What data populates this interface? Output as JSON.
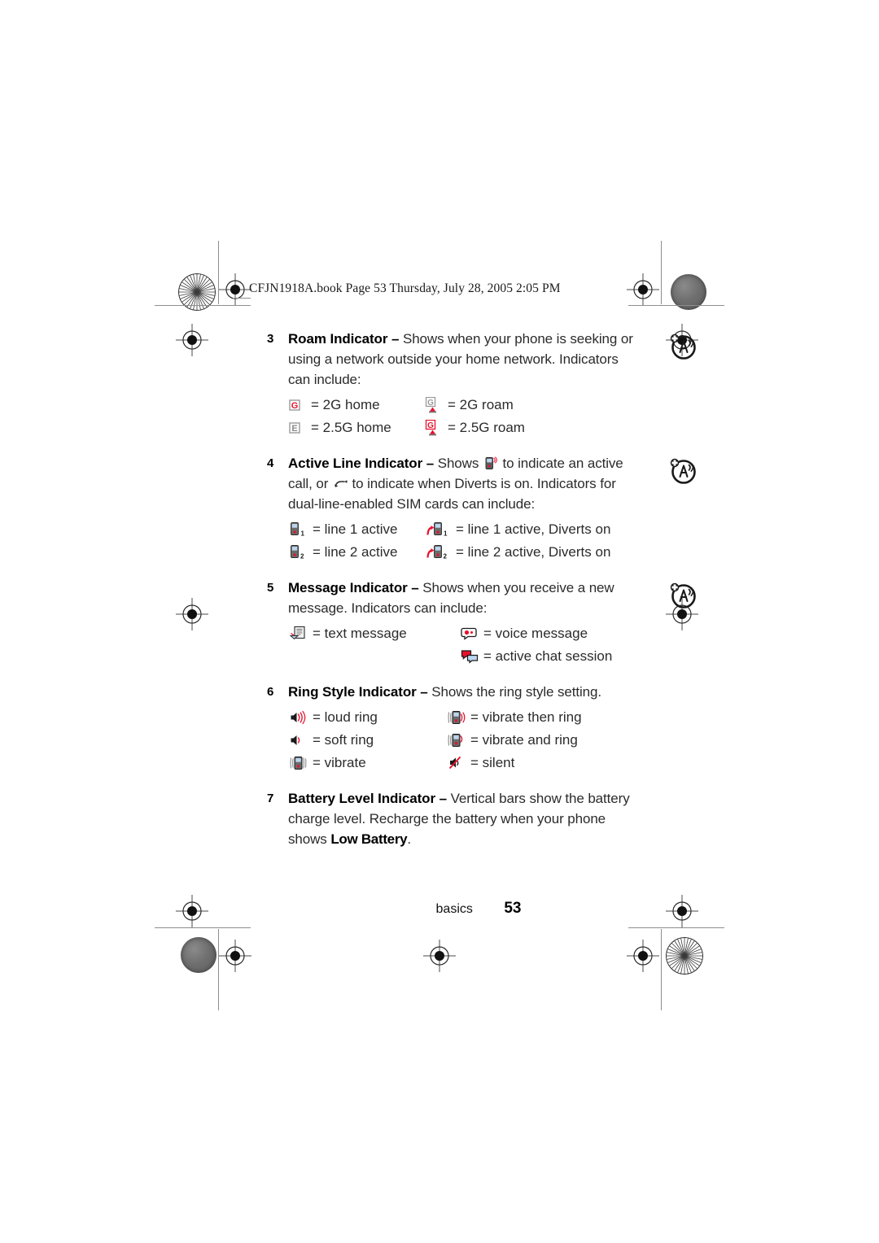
{
  "print_header": "CFJN1918A.book  Page 53  Thursday, July 28, 2005  2:05 PM",
  "items": [
    {
      "number": "3",
      "title": "Roam Indicator",
      "dash": "–",
      "body": " Shows when your phone is seeking or using a network outside your home network. Indicators can include:",
      "margin_icon": "roam-antenna-icon",
      "rows": [
        {
          "left_icon": "2g-home-icon",
          "left_label": "= 2G home",
          "right_icon": "2g-roam-icon",
          "right_label": "= 2G roam"
        },
        {
          "left_icon": "25g-home-icon",
          "left_label": "= 2.5G home",
          "right_icon": "25g-roam-icon",
          "right_label": "= 2.5G roam"
        }
      ]
    },
    {
      "number": "4",
      "title": "Active Line Indicator",
      "dash": "–",
      "body_pre": " Shows ",
      "body_mid": " to indicate an active call, or ",
      "body_post": " to indicate when Diverts is on. Indicators for dual-line-enabled SIM cards can include:",
      "inline_icon_1": "active-call-phone-icon",
      "inline_icon_2": "divert-icon",
      "margin_icon": "roam-antenna-icon",
      "rows": [
        {
          "left_icon": "line1-active-icon",
          "left_label": "= line 1 active",
          "right_icon": "line1-divert-icon",
          "right_label": "= line 1 active, Diverts on"
        },
        {
          "left_icon": "line2-active-icon",
          "left_label": "= line 2 active",
          "right_icon": "line2-divert-icon",
          "right_label": "= line 2 active, Diverts on"
        }
      ]
    },
    {
      "number": "5",
      "title": "Message Indicator",
      "dash": "–",
      "body": " Shows when you receive a new message. Indicators can include:",
      "margin_icon": "roam-antenna-icon",
      "rows": [
        {
          "left_icon": "text-message-icon",
          "left_label": "= text message",
          "right_icon": "voice-message-icon",
          "right_label": "= voice message"
        },
        {
          "left_icon": "",
          "left_label": "",
          "right_icon": "chat-session-icon",
          "right_label": "= active chat session"
        }
      ]
    },
    {
      "number": "6",
      "title": "Ring Style Indicator",
      "dash": "–",
      "body": " Shows the ring style setting.",
      "margin_icon": "",
      "rows": [
        {
          "left_icon": "loud-ring-icon",
          "left_label": "= loud ring",
          "right_icon": "vibrate-then-ring-icon",
          "right_label": "= vibrate then ring"
        },
        {
          "left_icon": "soft-ring-icon",
          "left_label": "= soft ring",
          "right_icon": "vibrate-and-ring-icon",
          "right_label": "= vibrate and ring"
        },
        {
          "left_icon": "vibrate-icon",
          "left_label": "= vibrate",
          "right_icon": "silent-icon",
          "right_label": "= silent"
        }
      ]
    },
    {
      "number": "7",
      "title": "Battery Level Indicator",
      "dash": "–",
      "body_pre": " Vertical bars show the battery charge level. Recharge the battery when your phone shows ",
      "body_strong": "Low Battery",
      "body_post": ".",
      "margin_icon": "",
      "rows": []
    }
  ],
  "footer": {
    "section": "basics",
    "page_number": "53"
  },
  "colors": {
    "accent_red": "#e8112d",
    "gray_icon": "#8b8b8b",
    "blue_icon": "#2a6ebb",
    "text": "#2b2b2b"
  }
}
